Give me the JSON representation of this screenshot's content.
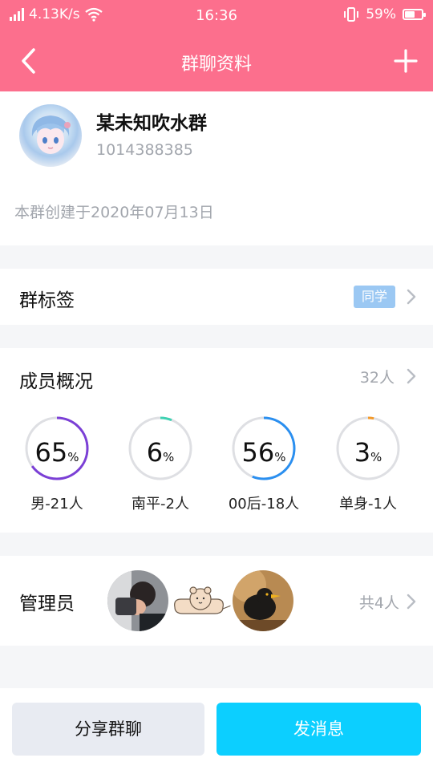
{
  "status_bar": {
    "net_speed": "4.13K/s",
    "time": "16:36",
    "battery": "59%",
    "battery_level": 0.59
  },
  "header": {
    "title": "群聊资料"
  },
  "group": {
    "name": "某未知吹水群",
    "id": "1014388385",
    "created": "本群创建于2020年07月13日"
  },
  "tags": {
    "label": "群标签",
    "badge": "同学"
  },
  "members": {
    "label": "成员概况",
    "count": "32人",
    "stats": [
      {
        "value": "65",
        "unit": "%",
        "label": "男-21人",
        "percent": 65,
        "color": "#7b3fd6"
      },
      {
        "value": "6",
        "unit": "%",
        "label": "南平-2人",
        "percent": 6,
        "color": "#3fd1b2"
      },
      {
        "value": "56",
        "unit": "%",
        "label": "00后-18人",
        "percent": 56,
        "color": "#2a8ff0"
      },
      {
        "value": "3",
        "unit": "%",
        "label": "单身-1人",
        "percent": 3,
        "color": "#f39a2b"
      }
    ]
  },
  "admins": {
    "label": "管理员",
    "count": "共4人"
  },
  "actions": {
    "share": "分享群聊",
    "send": "发消息"
  },
  "colors": {
    "header": "#fc6f8d",
    "primary_button": "#0ccfff",
    "secondary_button": "#e8ebf2",
    "tag_badge": "#9bc8f3",
    "muted_text": "#a2a6ad"
  }
}
